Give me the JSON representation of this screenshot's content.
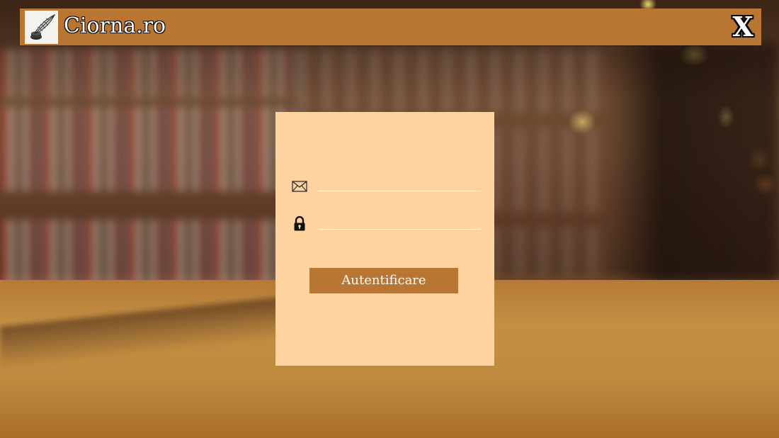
{
  "app": {
    "title": "Ciorna.ro",
    "close_label": "X",
    "logo_icon": "quill-pen-icon"
  },
  "login": {
    "email_icon": "envelope-icon",
    "email_value": "",
    "email_placeholder": "",
    "password_icon": "lock-icon",
    "password_value": "",
    "password_placeholder": "",
    "submit_label": "Autentificare",
    "register_link_label": ""
  },
  "colors": {
    "header_bg": "#b87632",
    "panel_bg": "#fed39f",
    "button_bg": "#b87632",
    "text_light": "#ffffff"
  }
}
